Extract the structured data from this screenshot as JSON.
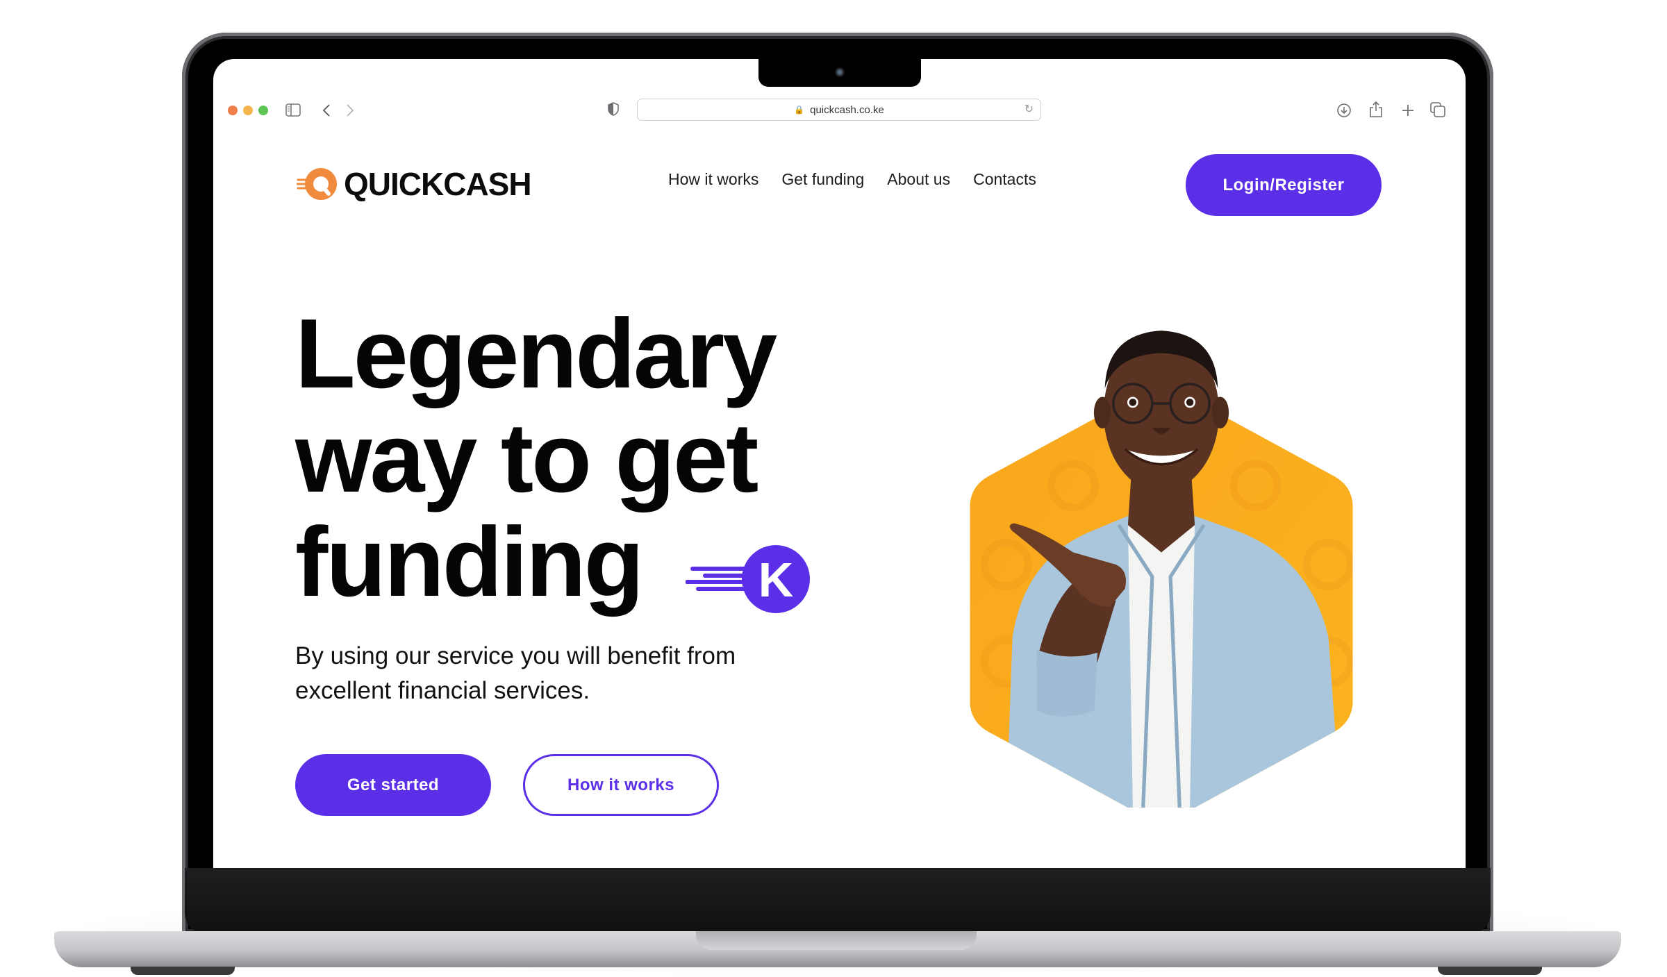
{
  "browser": {
    "url": "quickcash.co.ke",
    "traffic_lights": {
      "close": "#ee7d4a",
      "minimize": "#f4b54c",
      "zoom": "#5ec453"
    },
    "icons": [
      "sidebar-icon",
      "back-icon",
      "forward-icon",
      "shield-icon",
      "lock-icon",
      "reload-icon",
      "download-icon",
      "share-icon",
      "new-tab-icon",
      "tabs-overview-icon"
    ]
  },
  "site": {
    "brand": "QUICKCASH",
    "brand_colors": {
      "primary": "#5b2ee8",
      "accent": "#f08a3c",
      "hex_bg": "#fbae1d"
    },
    "nav": [
      {
        "label": "How it works"
      },
      {
        "label": "Get funding"
      },
      {
        "label": "About us"
      },
      {
        "label": "Contacts"
      }
    ],
    "login_label": "Login/Register"
  },
  "hero": {
    "title_lines": [
      "Legendary",
      "way to get",
      "funding"
    ],
    "badge_letter": "K",
    "subtitle": "By using our service you will benefit from excellent financial services.",
    "primary_cta": "Get started",
    "secondary_cta": "How it works",
    "image_alt": "Smiling man in glasses and denim shirt pointing with thumb"
  }
}
